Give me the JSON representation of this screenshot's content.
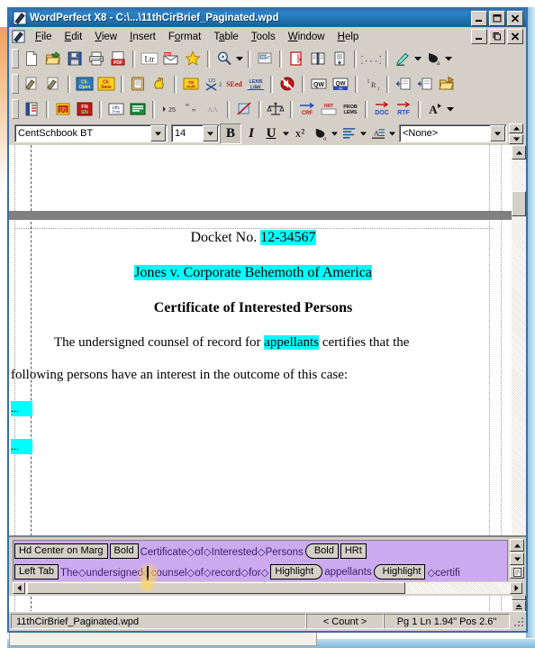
{
  "window": {
    "title": "WordPerfect X8 - C:\\...\\11thCirBrief_Paginated.wpd",
    "app_icon": "wordperfect-pen-icon",
    "minimize_label": "_",
    "maximize_label": "□",
    "close_label": "✕",
    "mdi_minimize_label": "_",
    "mdi_restore_label": "❐",
    "mdi_close_label": "✕"
  },
  "menubar": {
    "doc_icon": "document-pen-icon",
    "items": [
      {
        "label": "File",
        "accel": "F"
      },
      {
        "label": "Edit",
        "accel": "E"
      },
      {
        "label": "View",
        "accel": "V"
      },
      {
        "label": "Insert",
        "accel": "I"
      },
      {
        "label": "Format",
        "accel": "o"
      },
      {
        "label": "Table",
        "accel": "a"
      },
      {
        "label": "Tools",
        "accel": "T"
      },
      {
        "label": "Window",
        "accel": "W"
      },
      {
        "label": "Help",
        "accel": "H"
      }
    ]
  },
  "toolbar1": {
    "buttons": [
      {
        "name": "new-document-icon",
        "tip": "New Document"
      },
      {
        "name": "open-folder-icon",
        "tip": "Open"
      },
      {
        "name": "save-floppy-icon",
        "tip": "Save"
      },
      {
        "name": "print-icon",
        "tip": "Print"
      },
      {
        "name": "publish-pdf-icon",
        "tip": "Publish to PDF"
      },
      {
        "name": "letterhead-ltr-icon",
        "tip": "Ltr"
      },
      {
        "name": "envelope-icon",
        "tip": "Envelope"
      },
      {
        "name": "favorites-star-icon",
        "tip": "Favorites"
      },
      {
        "name": "zoom-magnifier-icon",
        "tip": "Zoom"
      },
      {
        "name": "zoom-dropdown-arrow",
        "tip": "Zoom options"
      },
      {
        "name": "page-view-icon",
        "tip": "Page View"
      },
      {
        "name": "redline-page-icon",
        "tip": "Redline"
      },
      {
        "name": "book-compare-icon",
        "tip": "Compare Documents"
      },
      {
        "name": "page-number-icon",
        "tip": "Page Numbering"
      },
      {
        "name": "insert-field-icon",
        "tip": "Insert Field"
      },
      {
        "name": "highlighter-pen-icon",
        "tip": "Highlight"
      },
      {
        "name": "highlight-dropdown-arrow",
        "tip": "Highlight color"
      },
      {
        "name": "font-fill-color-icon",
        "tip": "Font Color"
      },
      {
        "name": "font-color-dropdown-arrow",
        "tip": "Font color options"
      }
    ]
  },
  "toolbar2": {
    "buttons": [
      {
        "name": "legal-toolbar-grip",
        "tip": "Toolbar handle"
      },
      {
        "name": "pen-document-a-icon",
        "tip": "Legal Tool A"
      },
      {
        "name": "pen-document-b-icon",
        "tip": "Legal Tool B"
      },
      {
        "name": "client-open-icon",
        "tip": "Cli. Open"
      },
      {
        "name": "client-save-icon",
        "tip": "Cli. Save"
      },
      {
        "name": "clipboard-paste-icon",
        "tip": "Paste"
      },
      {
        "name": "hand-highlight-icon",
        "tip": "Mark Text"
      },
      {
        "name": "table-of-authorities-icon",
        "tip": "TOA"
      },
      {
        "name": "footnote-x2-icon",
        "tip": "Footnote"
      },
      {
        "name": "seed-citation-icon",
        "tip": "SEed"
      },
      {
        "name": "lexis-link-icon",
        "tip": "LEXIS LINK"
      },
      {
        "name": "no-sound-icon",
        "tip": "Mute"
      },
      {
        "name": "quickword-icon",
        "tip": "QW"
      },
      {
        "name": "quickword-ok-icon",
        "tip": "QW OK"
      },
      {
        "name": "superscript-ra-icon",
        "tip": "Superscript"
      },
      {
        "name": "insert-page-left-icon",
        "tip": "Insert Page"
      },
      {
        "name": "insert-page-right-icon",
        "tip": "Insert Page 2"
      },
      {
        "name": "open-file-folder-icon",
        "tip": "Open File"
      }
    ]
  },
  "toolbar3": {
    "buttons": [
      {
        "name": "book-red-icon",
        "tip": "Reference"
      },
      {
        "name": "numbering-121-icon",
        "tip": "Numbering"
      },
      {
        "name": "footnote-endnote-icon",
        "tip": "FN / EN"
      },
      {
        "name": "label-print-icon",
        "tip": "Label Print"
      },
      {
        "name": "green-lines-icon",
        "tip": "Format Lines"
      },
      {
        "name": "line-spacing-25-icon",
        "tip": "25"
      },
      {
        "name": "quote-marks-icon",
        "tip": "Quotes"
      },
      {
        "name": "compare-aa-icon",
        "tip": "Compare"
      },
      {
        "name": "strikeout-icon",
        "tip": "Strikeout"
      },
      {
        "name": "scales-of-justice-icon",
        "tip": "Justice"
      },
      {
        "name": "crf-arrow-icon",
        "tip": "CRF"
      },
      {
        "name": "hrt-arrow-icon",
        "tip": "HRT"
      },
      {
        "name": "problems-icon",
        "tip": "PROB LEMS"
      },
      {
        "name": "save-as-doc-icon",
        "tip": "DOC"
      },
      {
        "name": "save-as-rtf-icon",
        "tip": "RTF"
      },
      {
        "name": "font-navigator-icon",
        "tip": "Font Navigator"
      },
      {
        "name": "font-navigator-dropdown-arrow",
        "tip": "Font options"
      }
    ]
  },
  "propertybar": {
    "font_name": "CentSchbook BT",
    "font_size": "14",
    "style_name": "<None>",
    "bold_label": "B",
    "italic_label": "I",
    "underline_label": "U",
    "superscript_label": "x²",
    "dropdown_glyph": "▼",
    "buttons": [
      {
        "name": "bold-button",
        "label": "B"
      },
      {
        "name": "italic-button",
        "label": "I"
      },
      {
        "name": "underline-button",
        "label": "U"
      },
      {
        "name": "underline-dropdown-arrow",
        "label": "▾"
      },
      {
        "name": "superscript-button",
        "label": "x²"
      },
      {
        "name": "font-color-button",
        "label": ""
      },
      {
        "name": "font-color-dropdown-arrow",
        "label": "▾"
      },
      {
        "name": "justification-button",
        "label": ""
      },
      {
        "name": "justification-dropdown-arrow",
        "label": "▾"
      },
      {
        "name": "line-spacing-button",
        "label": ""
      },
      {
        "name": "line-spacing-dropdown-arrow",
        "label": "▾"
      }
    ]
  },
  "document": {
    "line_docket_prefix": "Docket No. ",
    "line_docket_number": "12-34567",
    "line_case_name": "Jones v. Corporate Behemoth of America",
    "line_title": "Certificate of Interested Persons",
    "body_line1_a": "The undersigned counsel of record for ",
    "body_line1_hl": "appellants",
    "body_line1_b": " certifies that the",
    "body_line2": "following persons have an interest in the outcome of this case:",
    "blank_hl_1": "...",
    "blank_hl_2": "...",
    "highlight_color": "#00ffff"
  },
  "reveal_codes": {
    "row1": [
      {
        "type": "code",
        "shape": "plain",
        "label": "Hd Center on Marg"
      },
      {
        "type": "code",
        "shape": "plain",
        "label": "Bold"
      },
      {
        "type": "text",
        "label": "Certificate◇of◇Interested◇Persons"
      },
      {
        "type": "code",
        "shape": "right-tag",
        "label": "Bold"
      },
      {
        "type": "code",
        "shape": "plain",
        "label": "HRt"
      }
    ],
    "row2": [
      {
        "type": "code",
        "shape": "plain",
        "label": "Left Tab"
      },
      {
        "type": "text",
        "label": "The◇undersigned◇counsel◇of◇record◇for◇"
      },
      {
        "type": "code",
        "shape": "left-tag",
        "label": "Highlight"
      },
      {
        "type": "text",
        "label": "appellants"
      },
      {
        "type": "code",
        "shape": "right-tag",
        "label": "Highlight"
      },
      {
        "type": "text",
        "label": "◇certifi"
      }
    ],
    "background_color": "#ccaaf0"
  },
  "statusbar": {
    "filename": "11thCirBrief_Paginated.wpd",
    "count": "< Count >",
    "position": "Pg 1 Ln 1.94\" Pos 2.6\""
  },
  "scrollbars": {
    "up_arrow": "▲",
    "down_arrow": "▼",
    "left_arrow": "◄",
    "right_arrow": "►"
  }
}
